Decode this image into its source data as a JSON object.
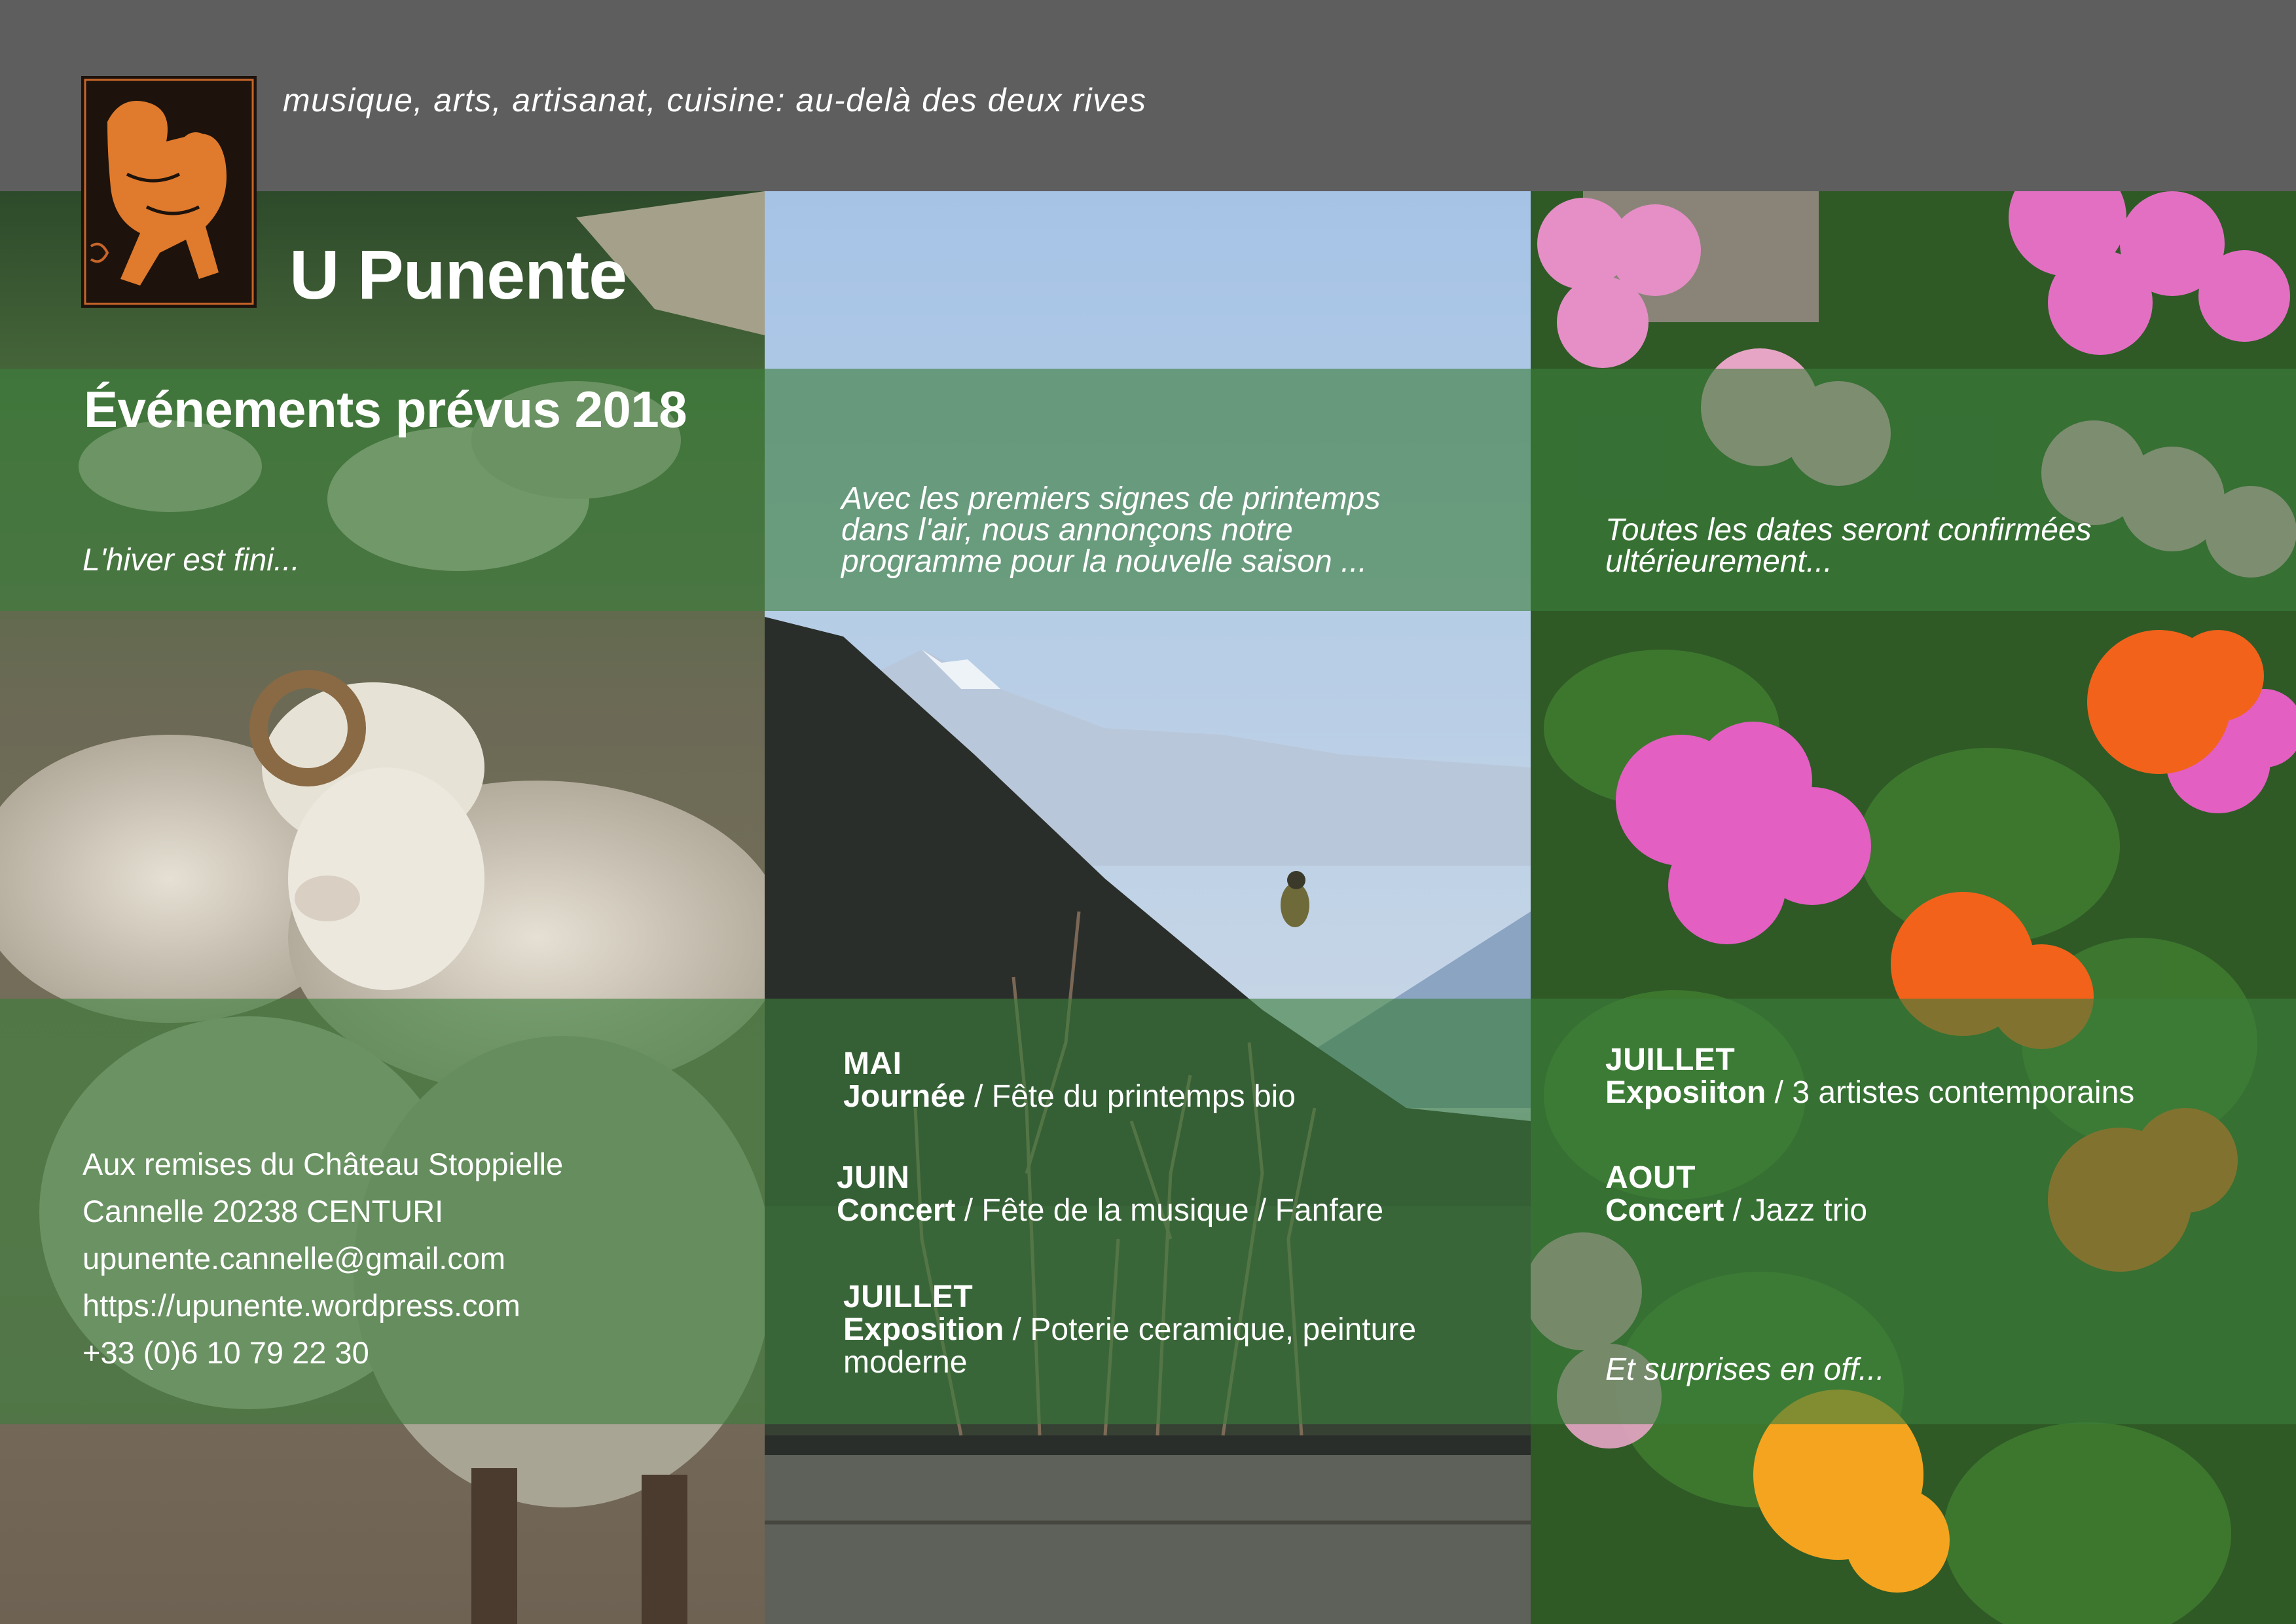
{
  "header": {
    "tagline": "musique, arts, artisanat, cuisine: au-delà des deux rives",
    "title": "U Punente"
  },
  "main": {
    "subtitle": "Événements prévus 2018",
    "intro_left": "L'hiver est fini...",
    "intro_mid": "Avec les premiers signes de printemps\ndans l'air, nous annonçons notre\nprogramme pour la nouvelle saison ...",
    "intro_right": "Toutes les dates seront confirmées\nultérieurement..."
  },
  "contact": {
    "line1": "Aux remises du Château Stoppielle",
    "line2": "Cannelle 20238 CENTURI",
    "email": "upunente.cannelle@gmail.com",
    "website": "https://upunente.wordpress.com",
    "phone": "+33 (0)6 10 79 22 30"
  },
  "events": {
    "mai": {
      "month": "MAI",
      "type": "Journée",
      "detail": " / Fête du printemps bio"
    },
    "juin": {
      "month": "JUIN",
      "type": "Concert",
      "detail": " / Fête de la musique / Fanfare"
    },
    "juillet": {
      "month": "JUILLET",
      "type": "Exposition",
      "detail": " / Poterie ceramique, peinture\nmoderne"
    },
    "juillet2": {
      "month": "JUILLET",
      "type": "Exposiiton",
      "detail": " / 3 artistes contemporains"
    },
    "aout": {
      "month": "AOUT",
      "type": "Concert",
      "detail": " / Jazz trio"
    },
    "surprises": "Et surprises en off..."
  },
  "colors": {
    "header_bg": "#5e5e5e",
    "band_green": "#3c7e3c",
    "text": "#ffffff"
  }
}
